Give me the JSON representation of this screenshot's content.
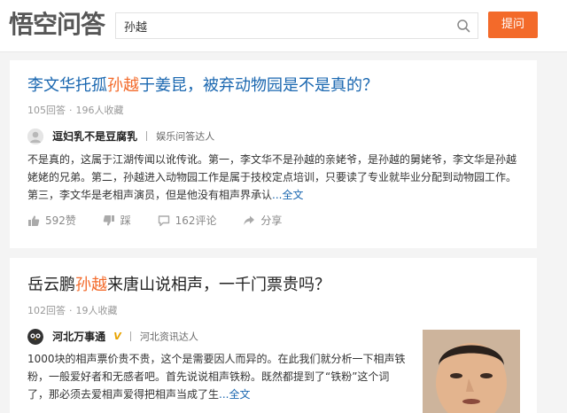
{
  "header": {
    "logo": "悟空问答",
    "search_value": "孙越",
    "ask_button": "提问"
  },
  "questions": [
    {
      "title_before": "李文华托孤",
      "title_highlight": "孙越",
      "title_after": "于姜昆，被弃动物园是不是真的？",
      "answers": "105回答",
      "bookmarks": "196人收藏",
      "author": "逗妇乳不是豆腐乳",
      "author_tag": "娱乐问答达人",
      "excerpt": "不是真的，这属于江湖传闻以讹传讹。第一，李文华不是孙越的亲姥爷，是孙越的舅姥爷，李文华是孙越姥姥的兄弟。第二，孙越进入动物园工作是属于技校定点培训，只要读了专业就毕业分配到动物园工作。第三，李文华是老相声演员，但是他没有相声界承认",
      "more": "...全文",
      "likes": "592赞",
      "dislike": "踩",
      "comments": "162评论",
      "share": "分享"
    },
    {
      "title_before": "岳云鹏",
      "title_highlight": "孙越",
      "title_after": "来唐山说相声，一千门票贵吗？",
      "answers": "102回答",
      "bookmarks": "19人收藏",
      "author": "河北万事通",
      "author_badge": "V",
      "author_tag": "河北资讯达人",
      "excerpt": "1000块的相声票价贵不贵，这个是需要因人而异的。在此我们就分析一下相声铁粉，一般爱好者和无感者吧。首先说说相声铁粉。既然都提到了“铁粉”这个词了，那必须去爱相声爱得把相声当成了生",
      "more": "...全文"
    }
  ],
  "colors": {
    "accent": "#f36a2a",
    "link": "#1a67b0"
  },
  "icons": [
    "search-icon",
    "like-icon",
    "dislike-icon",
    "comment-icon",
    "share-icon"
  ]
}
